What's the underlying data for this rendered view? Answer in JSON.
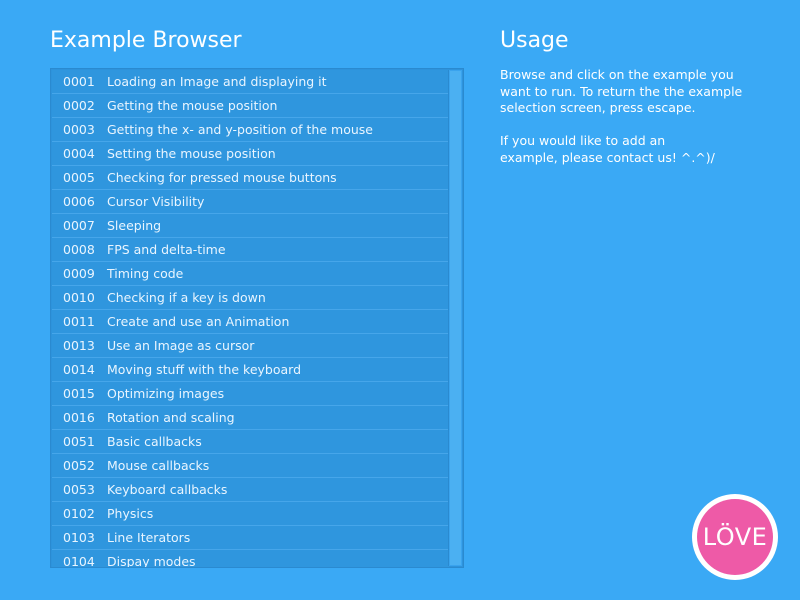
{
  "browser": {
    "title": "Example Browser",
    "items": [
      {
        "num": "0001",
        "label": "Loading an Image and displaying it"
      },
      {
        "num": "0002",
        "label": "Getting the mouse position"
      },
      {
        "num": "0003",
        "label": "Getting the x- and y-position of the mouse"
      },
      {
        "num": "0004",
        "label": "Setting the mouse position"
      },
      {
        "num": "0005",
        "label": "Checking for pressed mouse buttons"
      },
      {
        "num": "0006",
        "label": "Cursor Visibility"
      },
      {
        "num": "0007",
        "label": "Sleeping"
      },
      {
        "num": "0008",
        "label": "FPS and delta-time"
      },
      {
        "num": "0009",
        "label": "Timing code"
      },
      {
        "num": "0010",
        "label": "Checking if a key is down"
      },
      {
        "num": "0011",
        "label": "Create and use an Animation"
      },
      {
        "num": "0013",
        "label": "Use an Image as cursor"
      },
      {
        "num": "0014",
        "label": "Moving stuff with the keyboard"
      },
      {
        "num": "0015",
        "label": "Optimizing images"
      },
      {
        "num": "0016",
        "label": "Rotation and scaling"
      },
      {
        "num": "0051",
        "label": "Basic callbacks"
      },
      {
        "num": "0052",
        "label": "Mouse callbacks"
      },
      {
        "num": "0053",
        "label": "Keyboard callbacks"
      },
      {
        "num": "0102",
        "label": "Physics"
      },
      {
        "num": "0103",
        "label": "Line Iterators"
      },
      {
        "num": "0104",
        "label": "Dispay modes"
      }
    ]
  },
  "usage": {
    "title": "Usage",
    "paragraph1": "Browse and click on the example you\nwant to run. To return the the example\nselection screen, press escape.",
    "paragraph2": "If you would like to add an\nexample, please contact us! ^.^)/"
  },
  "logo": {
    "text": "LÖVE",
    "icon": "love-logo-icon"
  },
  "colors": {
    "background": "#3aa9f5",
    "list_row": "#2f96de",
    "logo_pink": "#ee5aa7"
  }
}
